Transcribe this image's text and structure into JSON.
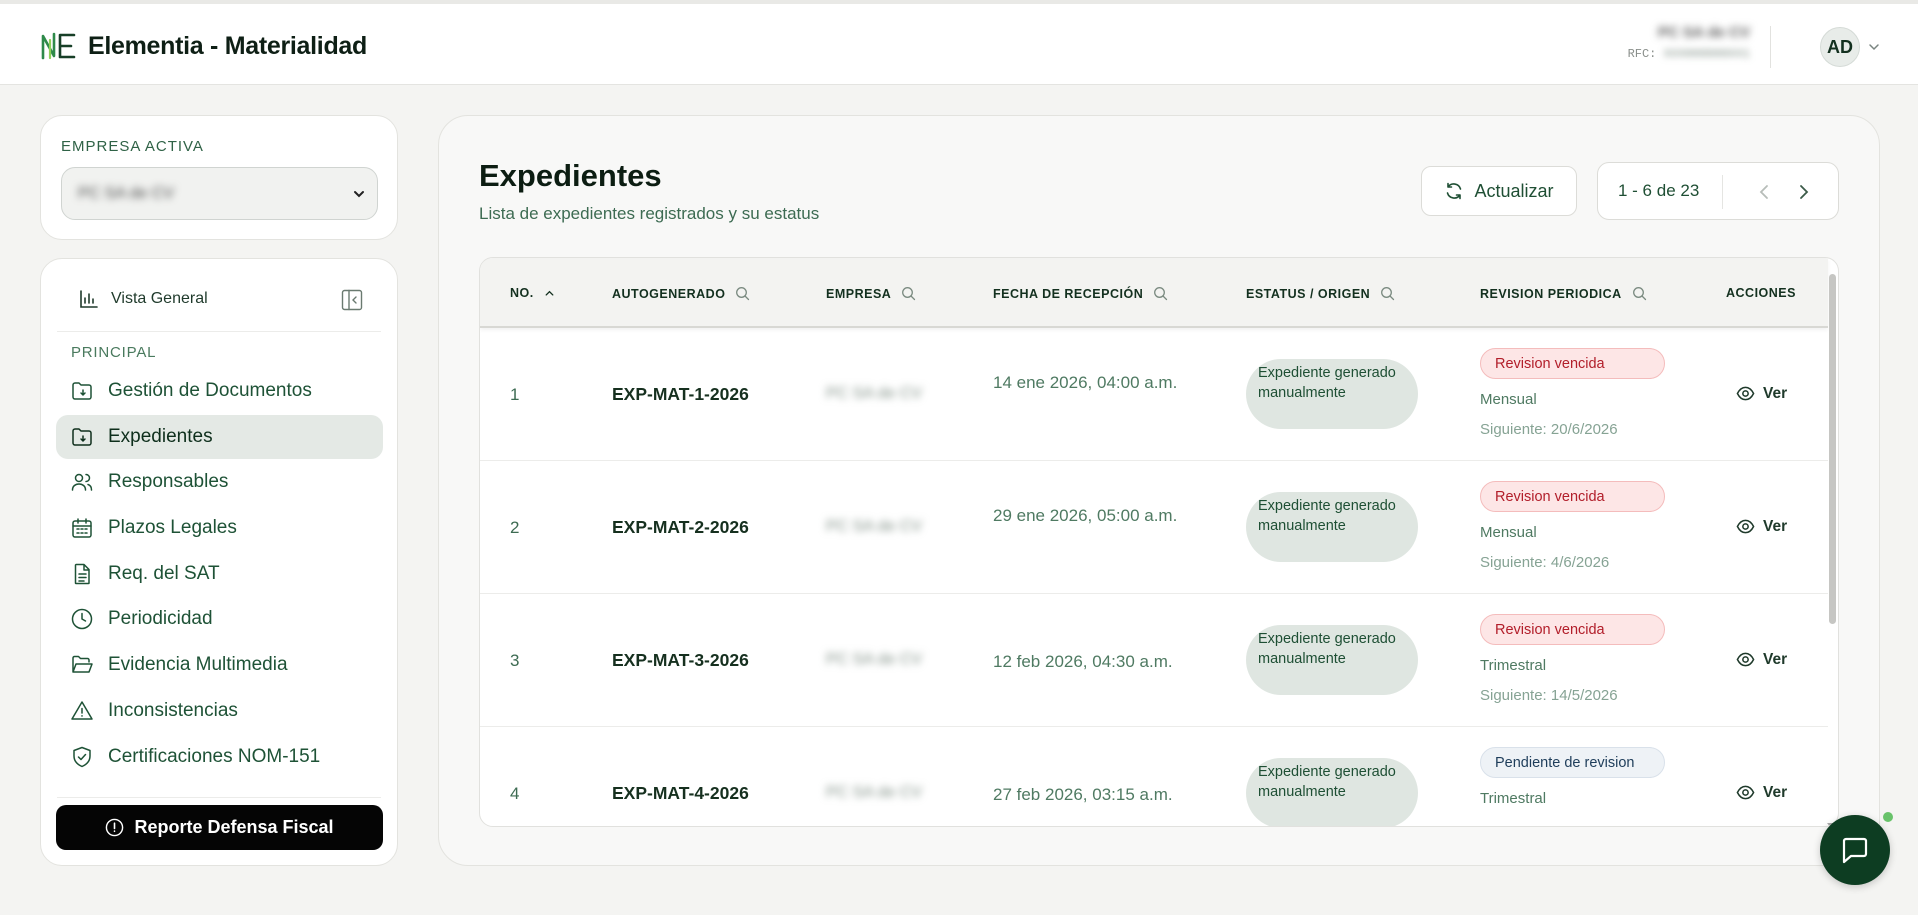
{
  "header": {
    "app_title": "Elementia - Materialidad",
    "company_name": "PC SA de CV",
    "rfc_label": "RFC:",
    "rfc_value": "XXX000000XX1",
    "avatar_initials": "AD"
  },
  "sidebar": {
    "empresa_label": "EMPRESA ACTIVA",
    "empresa_value": "PC SA de CV",
    "overview_label": "Vista General",
    "section_label": "PRINCIPAL",
    "items": [
      {
        "label": "Gestión de Documentos",
        "icon": "folder-doc-icon"
      },
      {
        "label": "Expedientes",
        "icon": "folder-doc-icon"
      },
      {
        "label": "Responsables",
        "icon": "users-icon"
      },
      {
        "label": "Plazos Legales",
        "icon": "calendar-icon"
      },
      {
        "label": "Req. del SAT",
        "icon": "document-icon"
      },
      {
        "label": "Periodicidad",
        "icon": "clock-icon"
      },
      {
        "label": "Evidencia Multimedia",
        "icon": "folder-open-icon"
      },
      {
        "label": "Inconsistencias",
        "icon": "warning-icon"
      },
      {
        "label": "Certificaciones NOM-151",
        "icon": "shield-check-icon"
      }
    ],
    "active_item": "Expedientes",
    "report_button": "Reporte Defensa Fiscal"
  },
  "main": {
    "title": "Expedientes",
    "subtitle": "Lista de expedientes registrados y su estatus",
    "refresh_label": "Actualizar",
    "pagination": "1 - 6 de 23"
  },
  "table": {
    "headers": {
      "no": "NO.",
      "autogenerado": "AUTOGENERADO",
      "empresa": "EMPRESA",
      "fecha": "FECHA DE RECEPCIÓN",
      "estatus": "ESTATUS / ORIGEN",
      "revision": "REVISION PERIODICA",
      "acciones": "ACCIONES"
    },
    "rows": [
      {
        "no": "1",
        "autogenerado": "EXP-MAT-1-2026",
        "empresa": "PC SA de CV",
        "fecha": "14 ene 2026, 04:00 a.m.",
        "estatus": "Expediente generado manualmente",
        "revision": "Revision vencida",
        "revision_kind": "vencida",
        "periodo": "Mensual",
        "siguiente": "Siguiente: 20/6/2026",
        "accion": "Ver"
      },
      {
        "no": "2",
        "autogenerado": "EXP-MAT-2-2026",
        "empresa": "PC SA de CV",
        "fecha": "29 ene 2026, 05:00 a.m.",
        "estatus": "Expediente generado manualmente",
        "revision": "Revision vencida",
        "revision_kind": "vencida",
        "periodo": "Mensual",
        "siguiente": "Siguiente: 4/6/2026",
        "accion": "Ver"
      },
      {
        "no": "3",
        "autogenerado": "EXP-MAT-3-2026",
        "empresa": "PC SA de CV",
        "fecha": "12 feb 2026, 04:30 a.m.",
        "estatus": "Expediente generado manualmente",
        "revision": "Revision vencida",
        "revision_kind": "vencida",
        "periodo": "Trimestral",
        "siguiente": "Siguiente: 14/5/2026",
        "accion": "Ver"
      },
      {
        "no": "4",
        "autogenerado": "EXP-MAT-4-2026",
        "empresa": "PC SA de CV",
        "fecha": "27 feb 2026, 03:15 a.m.",
        "estatus": "Expediente generado manualmente",
        "revision": "Pendiente de revision",
        "revision_kind": "pendiente",
        "periodo": "Trimestral",
        "siguiente": "",
        "accion": "Ver"
      }
    ]
  },
  "colors": {
    "brand_dark": "#0d3d22",
    "active_bg": "#e4e9e5",
    "danger": "#b21e2a",
    "status_bg": "#dfe6e1"
  }
}
